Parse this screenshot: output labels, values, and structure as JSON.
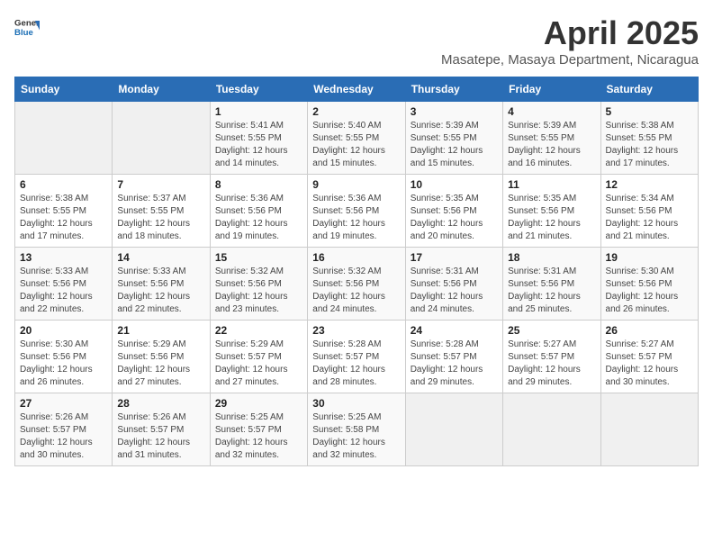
{
  "header": {
    "logo_general": "General",
    "logo_blue": "Blue",
    "title": "April 2025",
    "subtitle": "Masatepe, Masaya Department, Nicaragua"
  },
  "days_of_week": [
    "Sunday",
    "Monday",
    "Tuesday",
    "Wednesday",
    "Thursday",
    "Friday",
    "Saturday"
  ],
  "weeks": [
    [
      {
        "day": "",
        "sunrise": "",
        "sunset": "",
        "daylight": "",
        "empty": true
      },
      {
        "day": "",
        "sunrise": "",
        "sunset": "",
        "daylight": "",
        "empty": true
      },
      {
        "day": "1",
        "sunrise": "Sunrise: 5:41 AM",
        "sunset": "Sunset: 5:55 PM",
        "daylight": "Daylight: 12 hours and 14 minutes."
      },
      {
        "day": "2",
        "sunrise": "Sunrise: 5:40 AM",
        "sunset": "Sunset: 5:55 PM",
        "daylight": "Daylight: 12 hours and 15 minutes."
      },
      {
        "day": "3",
        "sunrise": "Sunrise: 5:39 AM",
        "sunset": "Sunset: 5:55 PM",
        "daylight": "Daylight: 12 hours and 15 minutes."
      },
      {
        "day": "4",
        "sunrise": "Sunrise: 5:39 AM",
        "sunset": "Sunset: 5:55 PM",
        "daylight": "Daylight: 12 hours and 16 minutes."
      },
      {
        "day": "5",
        "sunrise": "Sunrise: 5:38 AM",
        "sunset": "Sunset: 5:55 PM",
        "daylight": "Daylight: 12 hours and 17 minutes."
      }
    ],
    [
      {
        "day": "6",
        "sunrise": "Sunrise: 5:38 AM",
        "sunset": "Sunset: 5:55 PM",
        "daylight": "Daylight: 12 hours and 17 minutes."
      },
      {
        "day": "7",
        "sunrise": "Sunrise: 5:37 AM",
        "sunset": "Sunset: 5:55 PM",
        "daylight": "Daylight: 12 hours and 18 minutes."
      },
      {
        "day": "8",
        "sunrise": "Sunrise: 5:36 AM",
        "sunset": "Sunset: 5:56 PM",
        "daylight": "Daylight: 12 hours and 19 minutes."
      },
      {
        "day": "9",
        "sunrise": "Sunrise: 5:36 AM",
        "sunset": "Sunset: 5:56 PM",
        "daylight": "Daylight: 12 hours and 19 minutes."
      },
      {
        "day": "10",
        "sunrise": "Sunrise: 5:35 AM",
        "sunset": "Sunset: 5:56 PM",
        "daylight": "Daylight: 12 hours and 20 minutes."
      },
      {
        "day": "11",
        "sunrise": "Sunrise: 5:35 AM",
        "sunset": "Sunset: 5:56 PM",
        "daylight": "Daylight: 12 hours and 21 minutes."
      },
      {
        "day": "12",
        "sunrise": "Sunrise: 5:34 AM",
        "sunset": "Sunset: 5:56 PM",
        "daylight": "Daylight: 12 hours and 21 minutes."
      }
    ],
    [
      {
        "day": "13",
        "sunrise": "Sunrise: 5:33 AM",
        "sunset": "Sunset: 5:56 PM",
        "daylight": "Daylight: 12 hours and 22 minutes."
      },
      {
        "day": "14",
        "sunrise": "Sunrise: 5:33 AM",
        "sunset": "Sunset: 5:56 PM",
        "daylight": "Daylight: 12 hours and 22 minutes."
      },
      {
        "day": "15",
        "sunrise": "Sunrise: 5:32 AM",
        "sunset": "Sunset: 5:56 PM",
        "daylight": "Daylight: 12 hours and 23 minutes."
      },
      {
        "day": "16",
        "sunrise": "Sunrise: 5:32 AM",
        "sunset": "Sunset: 5:56 PM",
        "daylight": "Daylight: 12 hours and 24 minutes."
      },
      {
        "day": "17",
        "sunrise": "Sunrise: 5:31 AM",
        "sunset": "Sunset: 5:56 PM",
        "daylight": "Daylight: 12 hours and 24 minutes."
      },
      {
        "day": "18",
        "sunrise": "Sunrise: 5:31 AM",
        "sunset": "Sunset: 5:56 PM",
        "daylight": "Daylight: 12 hours and 25 minutes."
      },
      {
        "day": "19",
        "sunrise": "Sunrise: 5:30 AM",
        "sunset": "Sunset: 5:56 PM",
        "daylight": "Daylight: 12 hours and 26 minutes."
      }
    ],
    [
      {
        "day": "20",
        "sunrise": "Sunrise: 5:30 AM",
        "sunset": "Sunset: 5:56 PM",
        "daylight": "Daylight: 12 hours and 26 minutes."
      },
      {
        "day": "21",
        "sunrise": "Sunrise: 5:29 AM",
        "sunset": "Sunset: 5:56 PM",
        "daylight": "Daylight: 12 hours and 27 minutes."
      },
      {
        "day": "22",
        "sunrise": "Sunrise: 5:29 AM",
        "sunset": "Sunset: 5:57 PM",
        "daylight": "Daylight: 12 hours and 27 minutes."
      },
      {
        "day": "23",
        "sunrise": "Sunrise: 5:28 AM",
        "sunset": "Sunset: 5:57 PM",
        "daylight": "Daylight: 12 hours and 28 minutes."
      },
      {
        "day": "24",
        "sunrise": "Sunrise: 5:28 AM",
        "sunset": "Sunset: 5:57 PM",
        "daylight": "Daylight: 12 hours and 29 minutes."
      },
      {
        "day": "25",
        "sunrise": "Sunrise: 5:27 AM",
        "sunset": "Sunset: 5:57 PM",
        "daylight": "Daylight: 12 hours and 29 minutes."
      },
      {
        "day": "26",
        "sunrise": "Sunrise: 5:27 AM",
        "sunset": "Sunset: 5:57 PM",
        "daylight": "Daylight: 12 hours and 30 minutes."
      }
    ],
    [
      {
        "day": "27",
        "sunrise": "Sunrise: 5:26 AM",
        "sunset": "Sunset: 5:57 PM",
        "daylight": "Daylight: 12 hours and 30 minutes."
      },
      {
        "day": "28",
        "sunrise": "Sunrise: 5:26 AM",
        "sunset": "Sunset: 5:57 PM",
        "daylight": "Daylight: 12 hours and 31 minutes."
      },
      {
        "day": "29",
        "sunrise": "Sunrise: 5:25 AM",
        "sunset": "Sunset: 5:57 PM",
        "daylight": "Daylight: 12 hours and 32 minutes."
      },
      {
        "day": "30",
        "sunrise": "Sunrise: 5:25 AM",
        "sunset": "Sunset: 5:58 PM",
        "daylight": "Daylight: 12 hours and 32 minutes."
      },
      {
        "day": "",
        "sunrise": "",
        "sunset": "",
        "daylight": "",
        "empty": true
      },
      {
        "day": "",
        "sunrise": "",
        "sunset": "",
        "daylight": "",
        "empty": true
      },
      {
        "day": "",
        "sunrise": "",
        "sunset": "",
        "daylight": "",
        "empty": true
      }
    ]
  ]
}
